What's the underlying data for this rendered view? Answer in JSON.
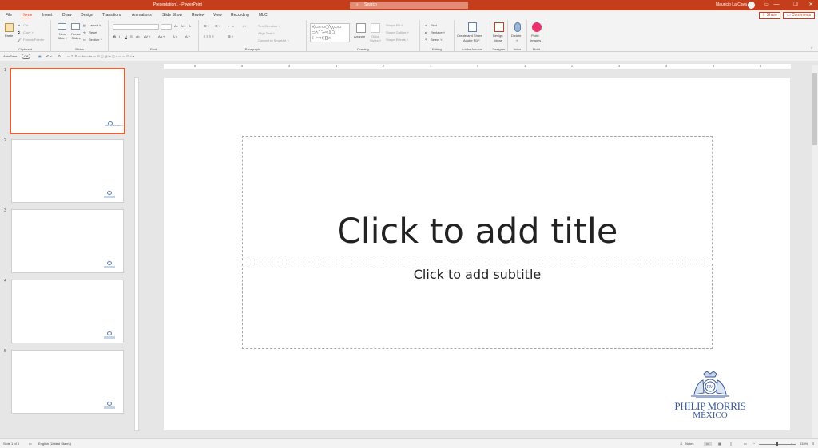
{
  "window": {
    "title": "Presentation1 - PowerPoint",
    "search_placeholder": "Search",
    "user": "Mauricio La Cava",
    "minimize": "—",
    "restore": "❐",
    "close": "✕",
    "ribbon_options": "▭"
  },
  "menu": {
    "tabs": [
      "File",
      "Home",
      "Insert",
      "Draw",
      "Design",
      "Transitions",
      "Animations",
      "Slide Show",
      "Review",
      "View",
      "Recording",
      "MLC"
    ],
    "active": "Home",
    "share": "Share",
    "comments": "Comments"
  },
  "ribbon": {
    "clipboard": {
      "paste": "Paste",
      "cut": "Cut",
      "copy": "Copy ˅",
      "format_painter": "Format Painter",
      "label": "Clipboard"
    },
    "slides": {
      "new_slide": "New Slide ˅",
      "reuse": "Reuse Slides",
      "layout": "Layout ˅",
      "reset": "Reset",
      "section": "Section ˅",
      "label": "Slides"
    },
    "font": {
      "grow": "A˄",
      "shrink": "A˅",
      "clear": "A",
      "bold": "B",
      "italic": "I",
      "underline": "U",
      "strike": "S",
      "shadow": "ab",
      "spacing": "AV ˅",
      "case": "Aa ˅",
      "highlight": "A ˅",
      "color": "A ˅",
      "label": "Font"
    },
    "paragraph": {
      "text_direction": "Text Direction ˅",
      "align_text": "Align Text ˅",
      "smartart": "Convert to SmartArt ˅",
      "label": "Paragraph"
    },
    "drawing": {
      "arrange": "Arrange",
      "quick_styles": "Quick Styles ˅",
      "shape_fill": "Shape Fill ˅",
      "shape_outline": "Shape Outline ˅",
      "shape_effects": "Shape Effects ˅",
      "label": "Drawing"
    },
    "editing": {
      "find": "Find",
      "replace": "Replace ˅",
      "select": "Select ˅",
      "label": "Editing"
    },
    "acrobat": {
      "create": "Create and Share",
      "create2": "Adobe PDF",
      "label": "Adobe Acrobat"
    },
    "designer": {
      "ideas": "Design",
      "ideas2": "Ideas",
      "label": "Designer"
    },
    "voice": {
      "dictate": "Dictate",
      "dictate2": "˅",
      "label": "Voice"
    },
    "pickit": {
      "images": "Pickit",
      "images2": "Images",
      "label": "Pickit"
    }
  },
  "qat": {
    "autosave": "AutoSave",
    "toggle": "Off"
  },
  "ruler": {
    "h_ticks": [
      "6",
      "5",
      "4",
      "3",
      "2",
      "1",
      "0",
      "1",
      "2",
      "3",
      "4",
      "5",
      "6"
    ]
  },
  "thumbnails": [
    {
      "num": "1",
      "selected": true
    },
    {
      "num": "2",
      "selected": false
    },
    {
      "num": "3",
      "selected": false
    },
    {
      "num": "4",
      "selected": false
    },
    {
      "num": "5",
      "selected": false
    }
  ],
  "slide": {
    "title_placeholder": "Click to add title",
    "subtitle_placeholder": "Click to add subtitle",
    "logo_line1": "PHILIP MORRIS",
    "logo_line2": "MÉXICO",
    "logo_mini_line1": "PHILIP MORRIS",
    "logo_mini_line2": "MÉXICO",
    "logo_seal": "PM"
  },
  "status": {
    "slide_counter": "Slide 1 of 5",
    "language": "English (United States)",
    "notes": "Notes",
    "zoom": "134%",
    "zoom_minus": "−",
    "zoom_plus": "+"
  },
  "colors": {
    "accent": "#c43e1c",
    "selected_thumb": "#e0613c",
    "logo_blue": "#3b5a9a"
  }
}
